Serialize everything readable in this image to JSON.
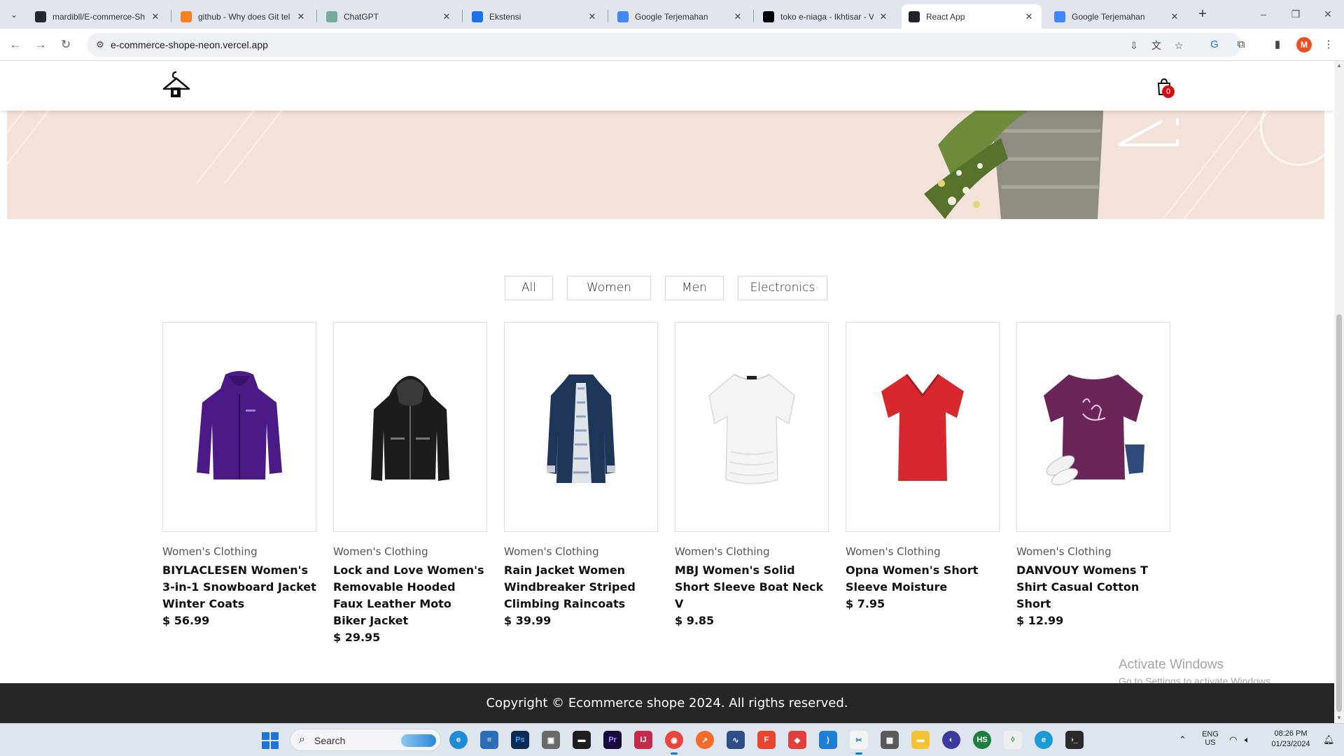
{
  "browser": {
    "tabs": [
      {
        "label": "mardibll/E-commerce-Sh",
        "favicon": "github-icon",
        "color": "#24292f"
      },
      {
        "label": "github - Why does Git tel",
        "favicon": "stackoverflow-icon",
        "color": "#f48024"
      },
      {
        "label": "ChatGPT",
        "favicon": "chatgpt-icon",
        "color": "#74aa9c"
      },
      {
        "label": "Ekstensi",
        "favicon": "puzzle-icon",
        "color": "#1a73e8"
      },
      {
        "label": "Google Terjemahan",
        "favicon": "google-translate-icon",
        "color": "#4285f4"
      },
      {
        "label": "toko e-niaga - Ikhtisar - V",
        "favicon": "vercel-icon",
        "color": "#000000"
      },
      {
        "label": "React App",
        "favicon": "react-icon",
        "color": "#20232a"
      },
      {
        "label": "Google Terjemahan",
        "favicon": "google-translate-icon",
        "color": "#4285f4"
      }
    ],
    "active_tab": 6,
    "url": "e-commerce-shope-neon.vercel.app",
    "profile_initial": "M"
  },
  "site": {
    "cart_count": "0",
    "filters": [
      "All",
      "Women",
      "Men",
      "Electronics"
    ],
    "products": [
      {
        "category": "Women's Clothing",
        "title": "BIYLACLESEN Women's 3-in-1 Snowboard Jacket Winter Coats",
        "price": "$ 56.99",
        "image": "purple-winter-jacket",
        "color": "#4b1a86"
      },
      {
        "category": "Women's Clothing",
        "title": "Lock and Love Women's Removable Hooded Faux Leather Moto Biker Jacket",
        "price": "$ 29.95",
        "image": "black-leather-jacket",
        "color": "#1c1c1c"
      },
      {
        "category": "Women's Clothing",
        "title": "Rain Jacket Women Windbreaker Striped Climbing Raincoats",
        "price": "$ 39.99",
        "image": "navy-raincoat",
        "color": "#1d3557"
      },
      {
        "category": "Women's Clothing",
        "title": "MBJ Women's Solid Short Sleeve Boat Neck V",
        "price": "$ 9.85",
        "image": "white-tshirt",
        "color": "#f4f4f4"
      },
      {
        "category": "Women's Clothing",
        "title": "Opna Women's Short Sleeve Moisture",
        "price": "$ 7.95",
        "image": "red-tshirt",
        "color": "#d7282f"
      },
      {
        "category": "Women's Clothing",
        "title": "DANVOUY Womens T Shirt Casual Cotton Short",
        "price": "$ 12.99",
        "image": "purple-be-kind-tshirt",
        "color": "#6b2659"
      }
    ],
    "footer": "Copyright © Ecommerce shope 2024. All rigths reserved."
  },
  "watermark": {
    "line1": "Activate Windows",
    "line2": "Go to Settings to activate Windows."
  },
  "taskbar": {
    "search_placeholder": "Search",
    "lang_top": "ENG",
    "lang_bottom": "US",
    "time": "08:26 PM",
    "date": "01/23/2024"
  }
}
